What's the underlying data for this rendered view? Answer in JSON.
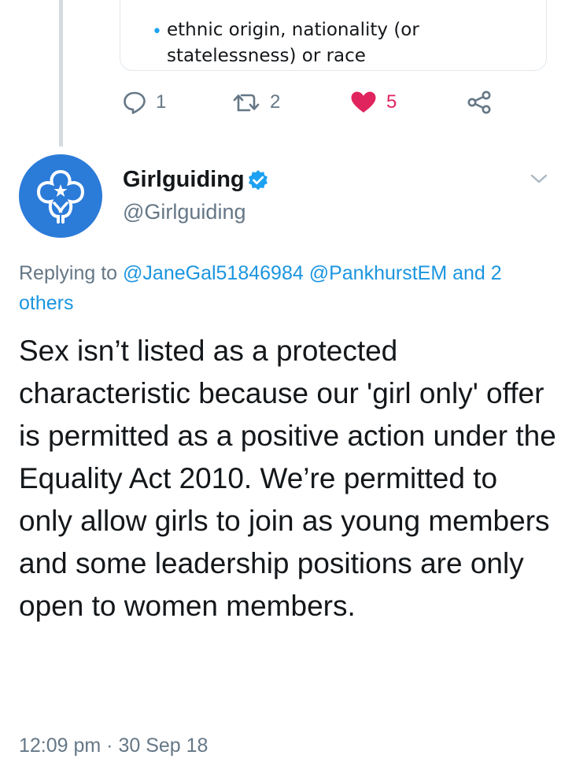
{
  "quoted": {
    "bullet_text": "ethnic origin, nationality (or statelessness) or race"
  },
  "actions": {
    "reply_count": "1",
    "retweet_count": "2",
    "like_count": "5",
    "icons": [
      "reply-icon",
      "retweet-icon",
      "heart-icon",
      "share-icon"
    ],
    "like_color": "#e0245e"
  },
  "tweet": {
    "author_name": "Girlguiding",
    "author_handle": "@Girlguiding",
    "verified": true,
    "replying_prefix": "Replying to",
    "replying_user_1": "@JaneGal51846984",
    "replying_user_2": "@PankhurstEM",
    "replying_others": "and 2 others",
    "text": "Sex isn’t listed as a protected characteristic because our 'girl only' offer is permitted as a positive action under the Equality Act 2010. We’re permitted to only allow girls to join as young members and some leadership positions are only open to women members.",
    "timestamp": "12:09 pm · 30 Sep 18"
  },
  "colors": {
    "avatar_bg": "#2b7bd9",
    "link": "#1b95e0",
    "verified": "#1da1f2",
    "muted": "#657786"
  }
}
